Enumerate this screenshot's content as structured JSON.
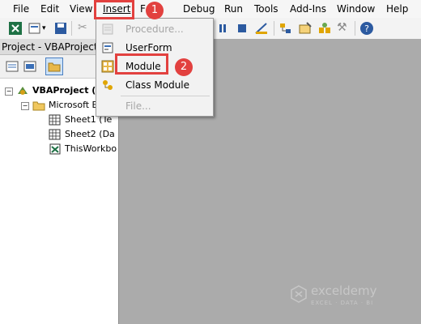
{
  "menubar": {
    "items": [
      "File",
      "Edit",
      "View",
      "Insert",
      "Format",
      "Debug",
      "Run",
      "Tools",
      "Add-Ins",
      "Window",
      "Help"
    ],
    "visible_format_label": "F"
  },
  "project_panel": {
    "title": "Project - VBAProject",
    "tree": [
      {
        "label": "VBAProject (P",
        "level": 0
      },
      {
        "label": "Microsoft Ex",
        "level": 1
      },
      {
        "label": "Sheet1 (Te",
        "level": 2
      },
      {
        "label": "Sheet2 (Da",
        "level": 2
      },
      {
        "label": "ThisWorkbo",
        "level": 2
      }
    ]
  },
  "insert_menu": {
    "items": [
      {
        "label": "Procedure...",
        "enabled": false,
        "icon": "procedure-icon"
      },
      {
        "label": "UserForm",
        "enabled": true,
        "icon": "userform-icon"
      },
      {
        "label": "Module",
        "enabled": true,
        "icon": "module-icon"
      },
      {
        "label": "Class Module",
        "enabled": true,
        "icon": "class-module-icon"
      },
      {
        "label": "File...",
        "enabled": false,
        "icon": ""
      }
    ]
  },
  "annotations": {
    "step1": "1",
    "step2": "2"
  },
  "watermark": {
    "name": "exceldemy",
    "tagline": "EXCEL · DATA · BI"
  },
  "colors": {
    "highlight": "#e2413f",
    "workspace": "#ababab"
  }
}
